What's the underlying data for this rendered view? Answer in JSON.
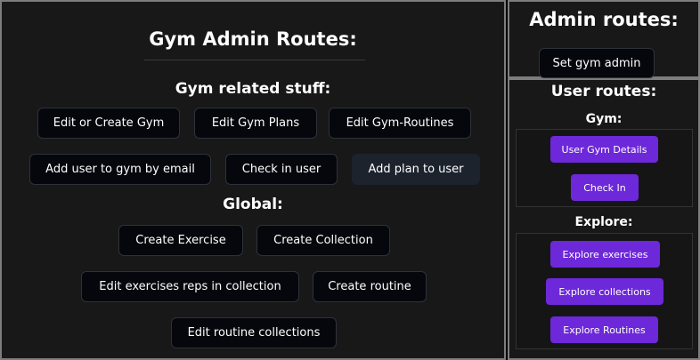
{
  "main": {
    "title": "Gym Admin Routes:",
    "gym_heading": "Gym related stuff:",
    "gym_buttons": [
      "Edit or Create Gym",
      "Edit Gym Plans",
      "Edit Gym-Routines",
      "Add user to gym by email",
      "Check in user",
      "Add plan to user"
    ],
    "global_heading": "Global:",
    "global_buttons": [
      "Create Exercise",
      "Create Collection",
      "Edit exercises reps in collection",
      "Create routine",
      "Edit routine collections"
    ]
  },
  "admin": {
    "title": "Admin routes:",
    "set_admin": "Set gym admin"
  },
  "user": {
    "title": "User routes:",
    "gym_heading": "Gym:",
    "gym_buttons": [
      "User Gym Details",
      "Check In"
    ],
    "explore_heading": "Explore:",
    "explore_buttons": [
      "Explore exercises",
      "Explore collections",
      "Explore Routines"
    ]
  },
  "colors": {
    "panel_bg": "#181818",
    "button_bg": "#05070c",
    "accent_purple": "#6d28d9"
  }
}
